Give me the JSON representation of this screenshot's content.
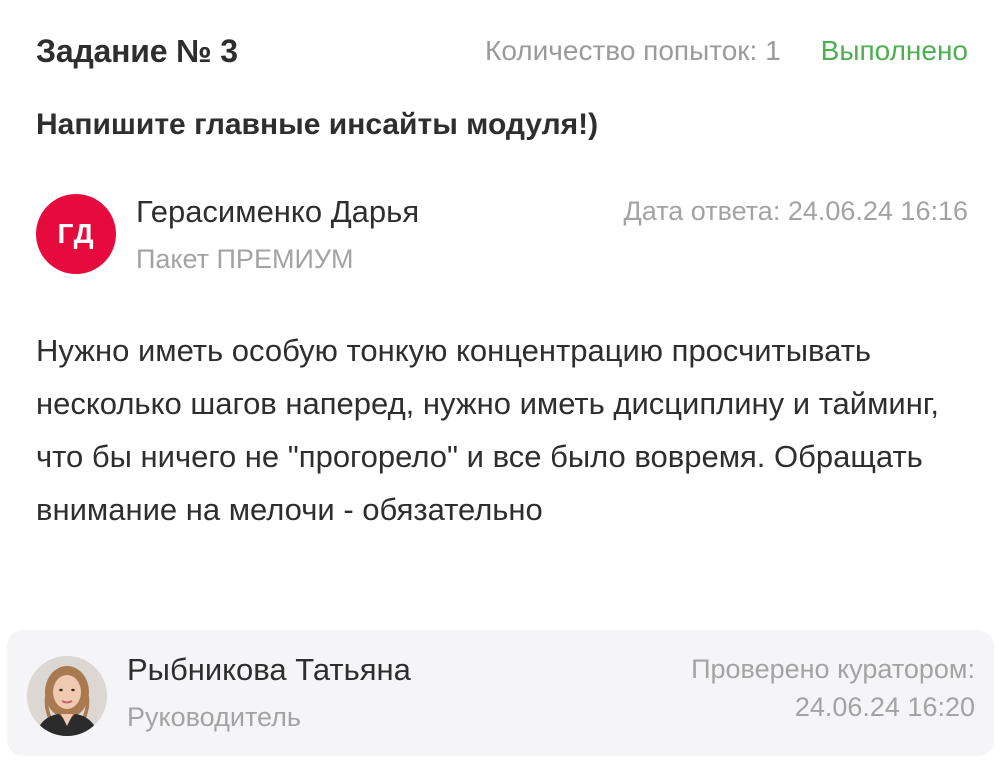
{
  "task": {
    "title": "Задание № 3",
    "attempts": "Количество попыток: 1",
    "status": "Выполнено",
    "question": "Напишите главные инсайты модуля!)"
  },
  "answer": {
    "initials": "ГД",
    "author": "Герасименко Дарья",
    "plan": "Пакет ПРЕМИУМ",
    "date": "Дата ответа: 24.06.24 16:16",
    "text": "Нужно иметь особую тонкую концентрацию просчитывать несколько шагов наперед, нужно иметь дисциплину и тайминг, что бы ничего не \"прогорело\" и все было вовремя. Обращать внимание на мелочи - обязательно",
    "avatar_color": "#e60a3d"
  },
  "curator": {
    "name": "Рыбникова Татьяна",
    "role": "Руководитель",
    "checked_label": "Проверено куратором:",
    "checked_date": "24.06.24 16:20"
  },
  "colors": {
    "status_green": "#4caf50",
    "muted_text": "#a3a3a3",
    "curator_bg": "#f5f5f7"
  }
}
